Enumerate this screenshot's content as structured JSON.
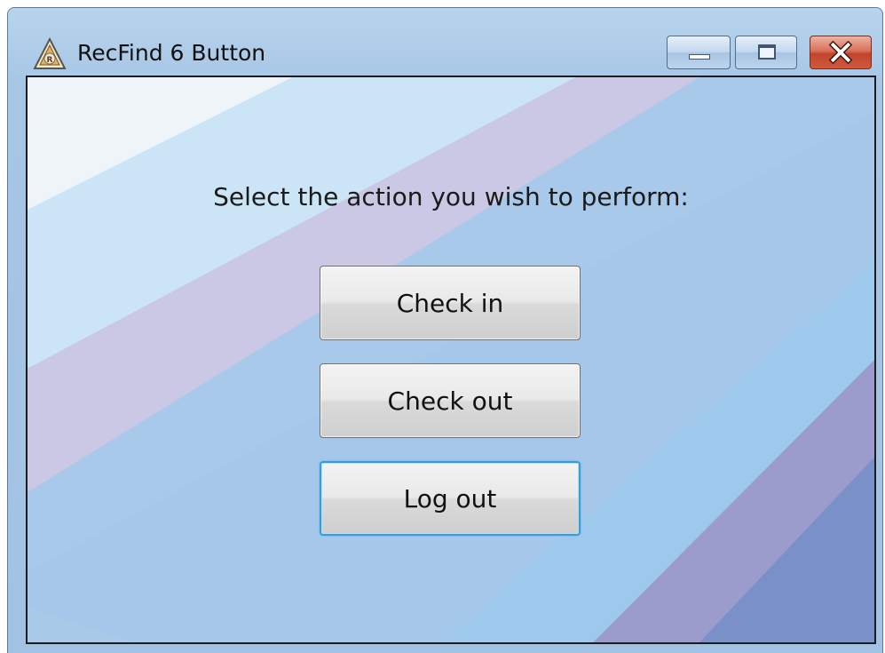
{
  "window": {
    "title": "RecFind 6 Button",
    "icon": "recfind-app-icon",
    "controls": {
      "minimize_icon": "minimize-icon",
      "maximize_icon": "maximize-icon",
      "close_icon": "close-icon"
    }
  },
  "dialog": {
    "prompt": "Select the action you wish to perform:",
    "buttons": [
      {
        "label": "Check in"
      },
      {
        "label": "Check out"
      },
      {
        "label": "Log out",
        "focused": true
      }
    ]
  },
  "colors": {
    "client_background": "#a8c8e8",
    "focus_border": "#3c9ad6",
    "close_button": "#c2432b"
  }
}
